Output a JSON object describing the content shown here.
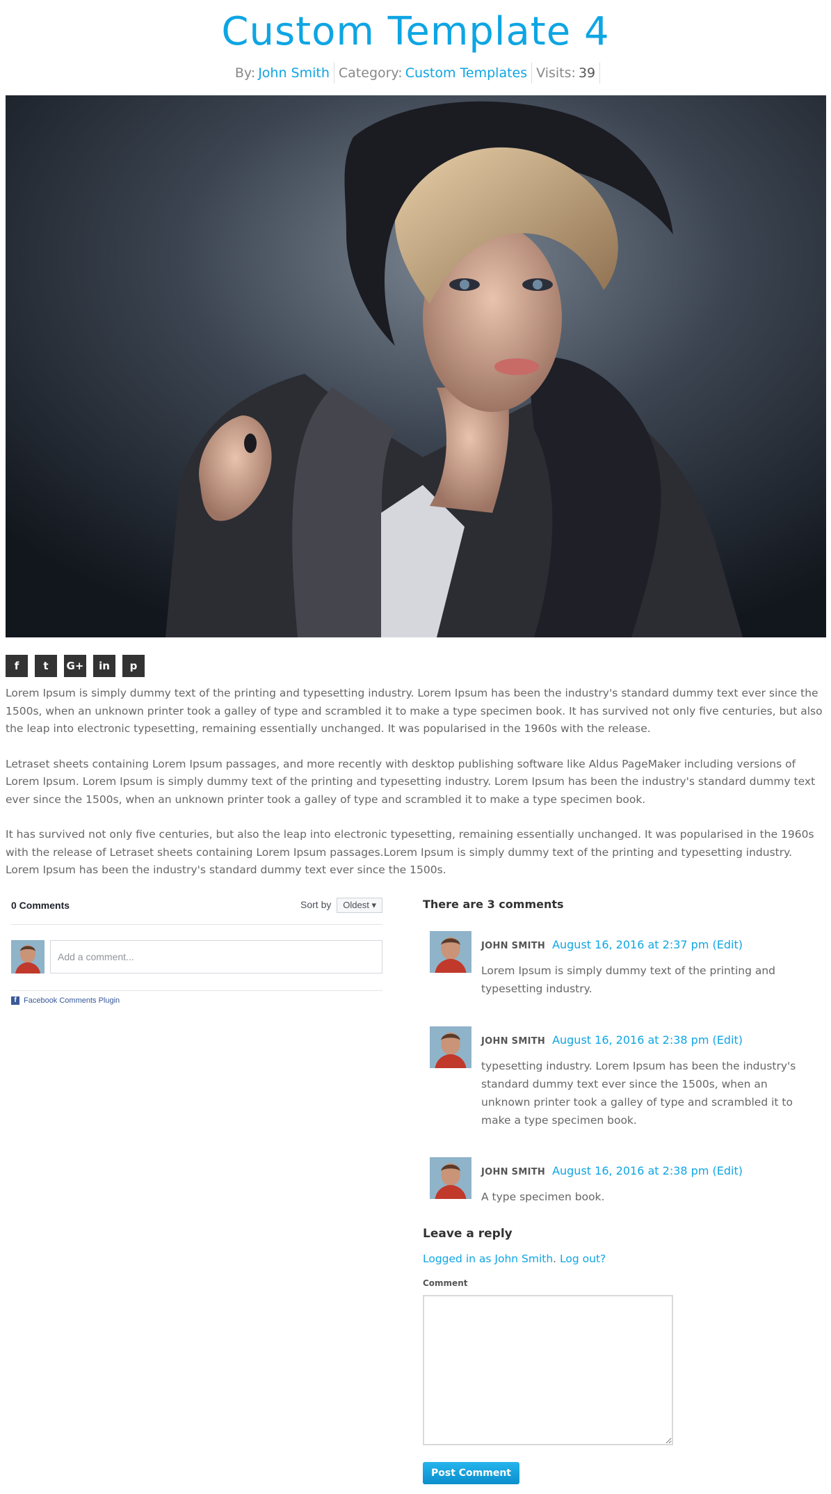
{
  "post": {
    "title": "Custom Template 4",
    "meta": {
      "by_label": "By:",
      "author": "John Smith",
      "category_label": "Category:",
      "category": "Custom Templates",
      "visits_label": "Visits:",
      "visits": "39"
    }
  },
  "share": {
    "buttons": [
      {
        "icon": "facebook-icon",
        "glyph": "f"
      },
      {
        "icon": "twitter-icon",
        "glyph": "t"
      },
      {
        "icon": "google-plus-icon",
        "glyph": "G+"
      },
      {
        "icon": "linkedin-icon",
        "glyph": "in"
      },
      {
        "icon": "pinterest-icon",
        "glyph": "p"
      }
    ]
  },
  "body": {
    "paragraphs": [
      "Lorem Ipsum is simply dummy text of the printing and typesetting industry. Lorem Ipsum has been the industry's standard dummy text ever since the 1500s, when an unknown printer took a galley of type and scrambled it to make a type specimen book. It has survived not only five centuries, but also the leap into electronic typesetting, remaining essentially unchanged. It was popularised in the 1960s with the release.",
      "Letraset sheets containing Lorem Ipsum passages, and more recently with desktop publishing software like Aldus PageMaker including versions of Lorem Ipsum. Lorem Ipsum is simply dummy text of the printing and typesetting industry. Lorem Ipsum has been the industry's standard dummy text ever since the 1500s, when an unknown printer took a galley of type and scrambled it to make a type specimen book.",
      "It has survived not only five centuries, but also the leap into electronic typesetting, remaining essentially unchanged. It was popularised in the 1960s with the release of Letraset sheets containing Lorem Ipsum passages.Lorem Ipsum is simply dummy text of the printing and typesetting industry. Lorem Ipsum has been the industry's standard dummy text ever since the 1500s."
    ]
  },
  "facebook": {
    "count_label": "0 Comments",
    "sort_label": "Sort by",
    "sort_value": "Oldest",
    "placeholder": "Add a comment...",
    "plugin_label": "Facebook Comments Plugin"
  },
  "comments": {
    "heading_prefix": "There are",
    "heading_count": "3 comments",
    "items": [
      {
        "author": "JOHN SMITH",
        "date": "August 16, 2016 at 2:37 pm",
        "edit": "(Edit)",
        "text": "Lorem Ipsum is simply dummy text of the printing and typesetting industry."
      },
      {
        "author": "JOHN SMITH",
        "date": "August 16, 2016 at 2:38 pm",
        "edit": "(Edit)",
        "text": "typesetting industry. Lorem Ipsum has been the industry's standard dummy text ever since the 1500s, when an unknown printer took a galley of type and scrambled it to make a type specimen book."
      },
      {
        "author": "JOHN SMITH",
        "date": "August 16, 2016 at 2:38 pm",
        "edit": "(Edit)",
        "text": "A type specimen book."
      }
    ]
  },
  "reply": {
    "heading": "Leave a reply",
    "logged_in_text": "Logged in as John Smith",
    "logout_text": "Log out?",
    "comment_label": "Comment",
    "submit_label": "Post Comment"
  },
  "colors": {
    "accent": "#0ea5e3",
    "text": "#666666",
    "share_bg": "#333333"
  }
}
